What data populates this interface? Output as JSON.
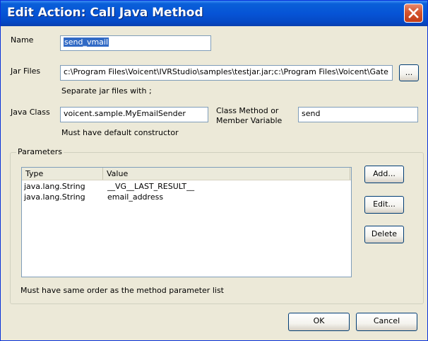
{
  "window": {
    "title": "Edit Action: Call Java Method"
  },
  "name": {
    "label": "Name",
    "value": "send_vmail"
  },
  "jar_files": {
    "label": "Jar Files",
    "value": "c:\\Program Files\\Voicent\\IVRStudio\\samples\\testjar.jar;c:\\Program Files\\Voicent\\Gate",
    "browse_label": "...",
    "hint": "Separate jar files with ;"
  },
  "java_class": {
    "label": "Java Class",
    "value": "voicent.sample.MyEmailSender",
    "hint": "Must have default constructor"
  },
  "class_method": {
    "label_line1": "Class Method or",
    "label_line2": "Member Variable",
    "value": "send"
  },
  "parameters": {
    "group_label": "Parameters",
    "columns": [
      "Type",
      "Value"
    ],
    "rows": [
      {
        "type": "java.lang.String",
        "value": "__VG__LAST_RESULT__"
      },
      {
        "type": "java.lang.String",
        "value": "email_address"
      }
    ],
    "add_label": "Add...",
    "edit_label": "Edit...",
    "delete_label": "Delete",
    "hint": "Must have same order as the method parameter list"
  },
  "footer": {
    "ok_label": "OK",
    "cancel_label": "Cancel"
  }
}
